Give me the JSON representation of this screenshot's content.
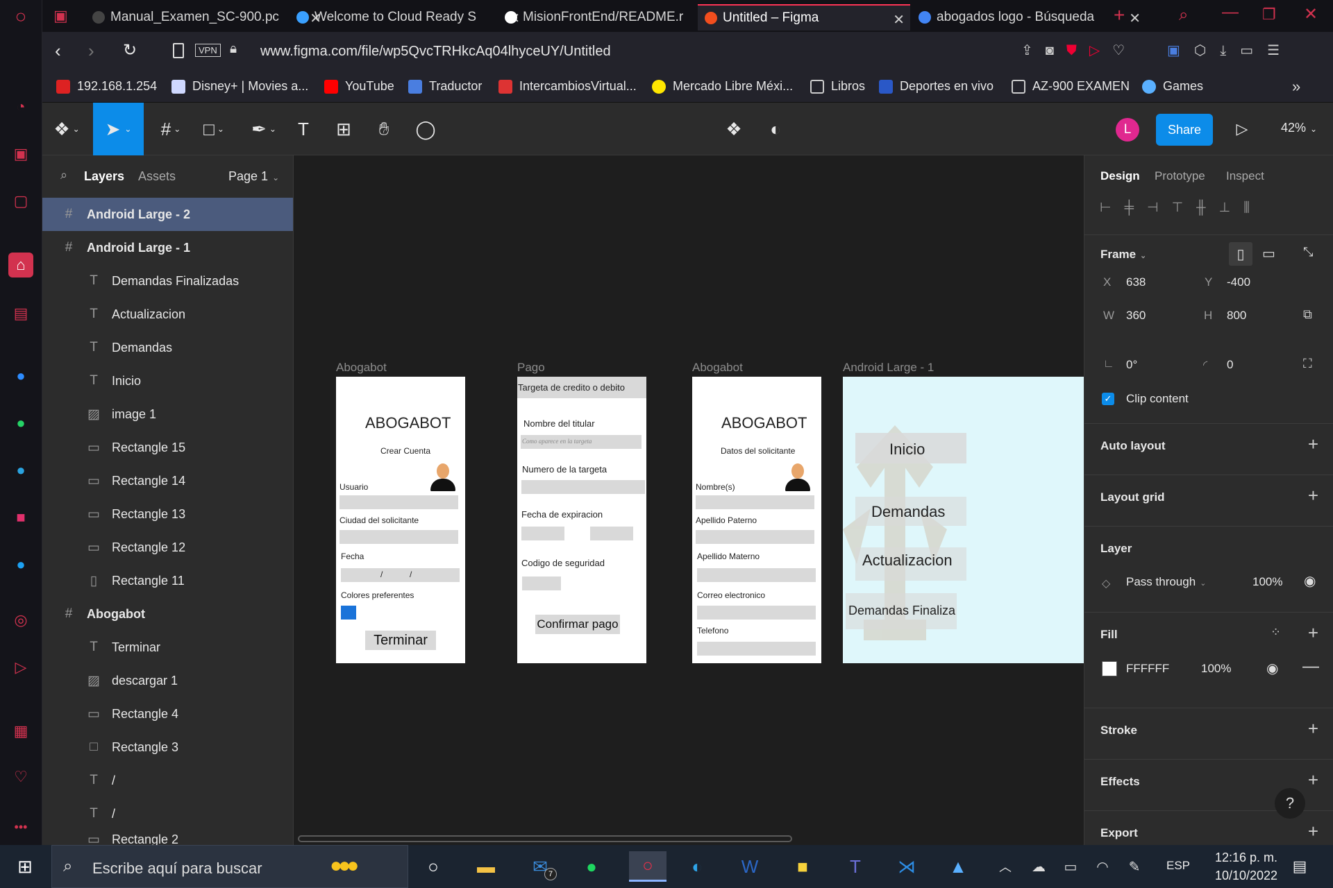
{
  "browser": {
    "tabs": [
      {
        "label": "Manual_Examen_SC-900.pc",
        "color": "#444"
      },
      {
        "label": "Welcome to Cloud Ready S",
        "color": "#3aa0ff"
      },
      {
        "label": "MisionFrontEnd/README.r",
        "color": "#ffffff"
      },
      {
        "label": "Untitled – Figma",
        "color": "#f24e1e"
      },
      {
        "label": "abogados logo - Búsqueda",
        "color": "#4285f4"
      }
    ],
    "url": "www.figma.com/file/wp5QvcTRHkcAq04lhyceUY/Untitled",
    "vpn_label": "VPN",
    "bookmarks": [
      {
        "label": "192.168.1.254",
        "color": "#d22"
      },
      {
        "label": "Disney+ | Movies a...",
        "color": "#cfd8ff"
      },
      {
        "label": "YouTube",
        "color": "#ff0000"
      },
      {
        "label": "Traductor",
        "color": "#4a7ee0"
      },
      {
        "label": "IntercambiosVirtual...",
        "color": "#d33"
      },
      {
        "label": "Mercado Libre Méxi...",
        "color": "#ffe600"
      },
      {
        "label": "Libros",
        "color": "#777"
      },
      {
        "label": "Deportes en vivo",
        "color": "#2a58c7"
      },
      {
        "label": "AZ-900 EXAMEN",
        "color": "#777"
      },
      {
        "label": "Games",
        "color": "#5ab0ff"
      }
    ]
  },
  "toolbar": {
    "avatar_initial": "L",
    "share_label": "Share",
    "zoom": "42%"
  },
  "layers": {
    "tab_layers": "Layers",
    "tab_assets": "Assets",
    "page": "Page 1",
    "items": [
      {
        "label": "Android Large - 2",
        "icon": "#",
        "level": 0,
        "selected": true
      },
      {
        "label": "Android Large - 1",
        "icon": "#",
        "level": 0
      },
      {
        "label": "Demandas Finalizadas",
        "icon": "T",
        "level": 1
      },
      {
        "label": "Actualizacion",
        "icon": "T",
        "level": 1
      },
      {
        "label": "Demandas",
        "icon": "T",
        "level": 1
      },
      {
        "label": "Inicio",
        "icon": "T",
        "level": 1
      },
      {
        "label": "image 1",
        "icon": "▨",
        "level": 1
      },
      {
        "label": "Rectangle 15",
        "icon": "▭",
        "level": 1
      },
      {
        "label": "Rectangle 14",
        "icon": "▭",
        "level": 1
      },
      {
        "label": "Rectangle 13",
        "icon": "▭",
        "level": 1
      },
      {
        "label": "Rectangle 12",
        "icon": "▭",
        "level": 1
      },
      {
        "label": "Rectangle 11",
        "icon": "▯",
        "level": 1
      },
      {
        "label": "Abogabot",
        "icon": "#",
        "level": 0
      },
      {
        "label": "Terminar",
        "icon": "T",
        "level": 1
      },
      {
        "label": "descargar 1",
        "icon": "▨",
        "level": 1
      },
      {
        "label": "Rectangle 4",
        "icon": "▭",
        "level": 1
      },
      {
        "label": "Rectangle 3",
        "icon": "□",
        "level": 1
      },
      {
        "label": "/",
        "icon": "T",
        "level": 1
      },
      {
        "label": "/",
        "icon": "T",
        "level": 1
      },
      {
        "label": "Rectangle 2",
        "icon": "▭",
        "level": 1
      }
    ]
  },
  "canvas": {
    "frame1": {
      "label": "Abogabot",
      "title": "ABOGABOT",
      "subtitle": "Crear Cuenta",
      "f_usuario": "Usuario",
      "f_ciudad": "Ciudad del solicitante",
      "f_fecha": "Fecha",
      "slash1": "/",
      "slash2": "/",
      "f_colores": "Colores preferentes",
      "button": "Terminar",
      "swatch_color": "#1a73d9"
    },
    "frame2": {
      "label": "Pago",
      "header": "Targeta de credito o debito",
      "f_nombre": "Nombre del titular",
      "placeholder": "Como aparece en la targeta",
      "f_numero": "Numero de la targeta",
      "f_fecha": "Fecha de expiracion",
      "f_codigo": "Codigo de seguridad",
      "button": "Confirmar pago"
    },
    "frame3": {
      "label": "Abogabot",
      "title": "ABOGABOT",
      "subtitle": "Datos del solicitante",
      "f_nombres": "Nombre(s)",
      "f_paterno": "Apellido Paterno",
      "f_materno": "Apellido Materno",
      "f_correo": "Correo electronico",
      "f_telefono": "Telefono"
    },
    "frame4": {
      "label": "Android Large - 1",
      "inicio": "Inicio",
      "demandas": "Demandas",
      "actualizacion": "Actualizacion",
      "finalizadas": "Demandas Finaliza",
      "bg_color": "#dff7fb"
    }
  },
  "design": {
    "tabs": [
      "Design",
      "Prototype",
      "Inspect"
    ],
    "frame_label": "Frame",
    "x_label": "X",
    "x": "638",
    "y_label": "Y",
    "y": "-400",
    "w_label": "W",
    "w": "360",
    "h_label": "H",
    "h": "800",
    "rotation": "0°",
    "radius": "0",
    "clip_content": "Clip content",
    "auto_layout": "Auto layout",
    "layout_grid": "Layout grid",
    "layer": "Layer",
    "blend": "Pass through",
    "opacity": "100%",
    "fill": "Fill",
    "fill_hex": "FFFFFF",
    "fill_opacity": "100%",
    "stroke": "Stroke",
    "effects": "Effects",
    "export": "Export",
    "help": "?"
  },
  "taskbar": {
    "search_placeholder": "Escribe aquí para buscar",
    "language": "ESP",
    "time": "12:16 p. m.",
    "date": "10/10/2022",
    "mail_badge": "7"
  }
}
